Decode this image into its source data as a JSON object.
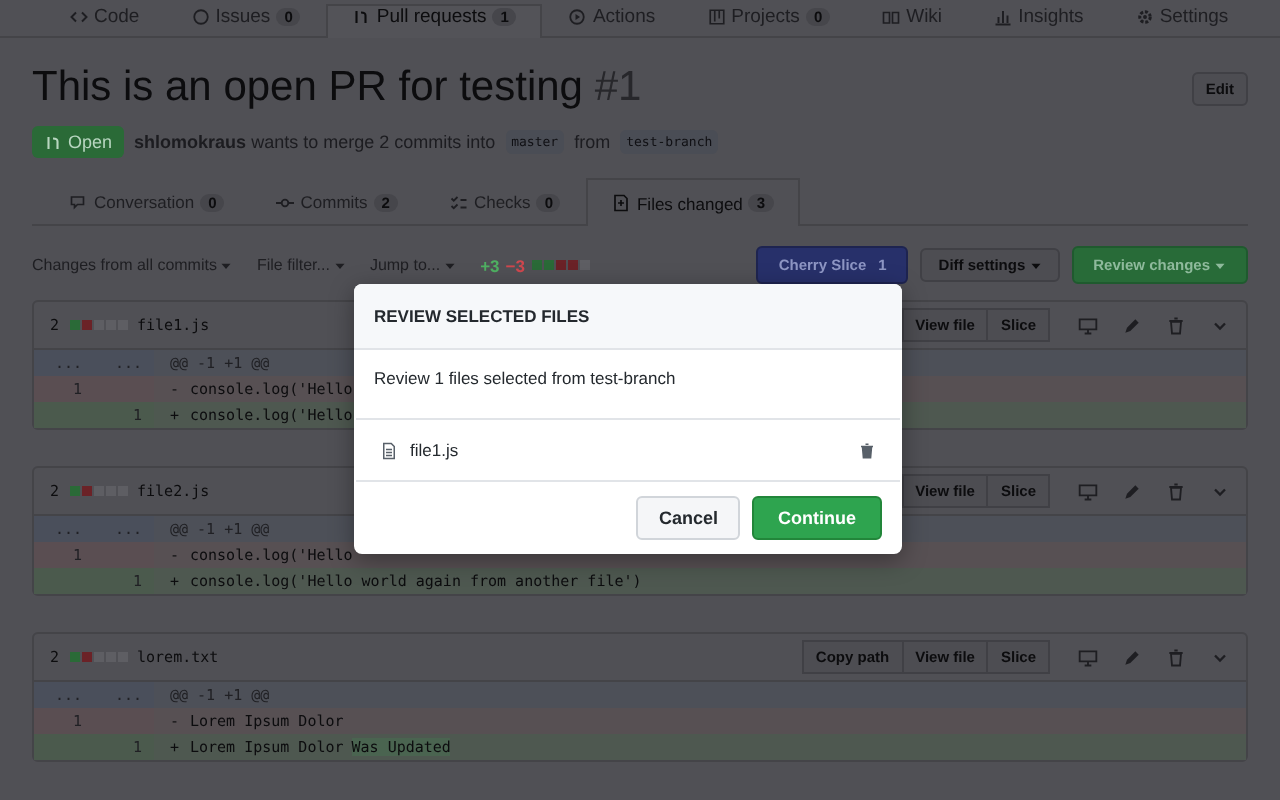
{
  "repo_tabs": [
    {
      "kind": "code",
      "label": "Code",
      "selected": false
    },
    {
      "kind": "issue",
      "label": "Issues",
      "count": "0",
      "selected": false
    },
    {
      "kind": "pr",
      "label": "Pull requests",
      "count": "1",
      "selected": true
    },
    {
      "kind": "actions",
      "label": "Actions",
      "selected": false
    },
    {
      "kind": "project",
      "label": "Projects",
      "count": "0",
      "selected": false
    },
    {
      "kind": "wiki",
      "label": "Wiki",
      "selected": false
    },
    {
      "kind": "insights",
      "label": "Insights",
      "selected": false
    },
    {
      "kind": "settings",
      "label": "Settings",
      "selected": false
    }
  ],
  "pr": {
    "title": "This is an open PR for testing",
    "number": "#1",
    "edit": "Edit",
    "state": "Open",
    "summary": "**shlomokraus** wants to merge 2 commits into",
    "base": "master",
    "from": "from",
    "head": "test-branch"
  },
  "pr_tabs": [
    {
      "kind": "conversation",
      "label": "Conversation",
      "count": "0",
      "selected": false
    },
    {
      "kind": "commits",
      "label": "Commits",
      "count": "2",
      "selected": false
    },
    {
      "kind": "checks",
      "label": "Checks",
      "count": "0",
      "selected": false
    },
    {
      "kind": "files",
      "label": "Files changed",
      "count": "3",
      "selected": true
    }
  ],
  "toolbar": {
    "menus": [
      "Changes from all commits",
      "File filter...",
      "Jump to..."
    ],
    "additions": "+3",
    "deletions": "−3",
    "blocks": [
      {
        "color": "#2a6a37"
      },
      {
        "color": "#2a6a37"
      },
      {
        "color": "#6b2227"
      },
      {
        "color": "#6b2227"
      },
      {
        "color": "#5e5e63"
      }
    ],
    "cherry": {
      "label": "Cherry Slice",
      "count": "1"
    },
    "diff_settings": "Diff settings",
    "review": "Review changes"
  },
  "files": [
    {
      "changes": "2",
      "name": "file1.js",
      "blocks": [
        {
          "color": "#2a6a37"
        },
        {
          "color": "#6b2227"
        },
        {
          "color": "#5e5e63"
        },
        {
          "color": "#5e5e63"
        },
        {
          "color": "#5e5e63"
        }
      ],
      "buttons": [
        "View file",
        "Slice"
      ],
      "lines": [
        {
          "kind": "hunk",
          "old": "...",
          "new": "...",
          "text": "@@ -1 +1 @@"
        },
        {
          "kind": "del",
          "old": "1",
          "sign": "-",
          "text": "console.log('Hello"
        },
        {
          "kind": "add",
          "new": "1",
          "sign": "+",
          "text": "console.log('Hello"
        }
      ]
    },
    {
      "changes": "2",
      "name": "file2.js",
      "blocks": [
        {
          "color": "#2a6a37"
        },
        {
          "color": "#6b2227"
        },
        {
          "color": "#5e5e63"
        },
        {
          "color": "#5e5e63"
        },
        {
          "color": "#5e5e63"
        }
      ],
      "buttons": [
        "View file",
        "Slice"
      ],
      "lines": [
        {
          "kind": "hunk",
          "old": "...",
          "new": "...",
          "text": "@@ -1 +1 @@"
        },
        {
          "kind": "del",
          "old": "1",
          "sign": "-",
          "text": "console.log('Hello"
        },
        {
          "kind": "add",
          "new": "1",
          "sign": "+",
          "text": "console.log('Hello world again from another file')"
        }
      ]
    },
    {
      "changes": "2",
      "name": "lorem.txt",
      "blocks": [
        {
          "color": "#2a6a37"
        },
        {
          "color": "#6b2227"
        },
        {
          "color": "#5e5e63"
        },
        {
          "color": "#5e5e63"
        },
        {
          "color": "#5e5e63"
        }
      ],
      "buttons": [
        "Copy path",
        "View file",
        "Slice"
      ],
      "lines": [
        {
          "kind": "hunk",
          "old": "...",
          "new": "...",
          "text": "@@ -1 +1 @@"
        },
        {
          "kind": "del",
          "old": "1",
          "sign": "-",
          "text": "Lorem Ipsum Dolor"
        },
        {
          "kind": "add",
          "new": "1",
          "sign": "+",
          "text": "Lorem Ipsum Dolor",
          "highlight": "Was Updated"
        }
      ]
    }
  ],
  "modal": {
    "title": "REVIEW SELECTED FILES",
    "message": "Review 1 files selected from test-branch",
    "files": [
      "file1.js"
    ],
    "cancel": "Cancel",
    "confirm": "Continue"
  }
}
